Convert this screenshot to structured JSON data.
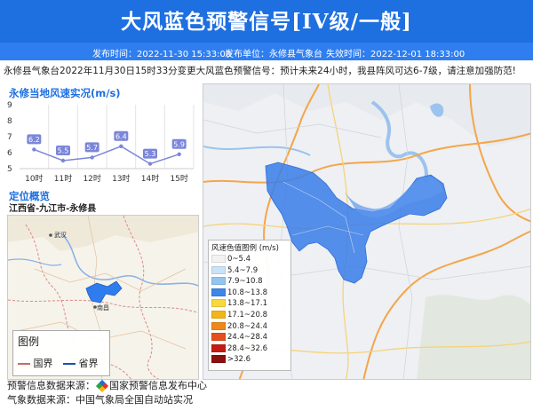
{
  "title": "大风蓝色预警信号[IV级/一般]",
  "subbar": {
    "issue_time": "发布时间：2022-11-30 15:33:00",
    "issuer": "发布单位：永修县气象台",
    "expire_time": "失效时间：2022-12-01 18:33:00"
  },
  "description": "永修县气象台2022年11月30日15时33分变更大风蓝色预警信号：预计未来24小时，我县阵风可达6-7级，请注意加强防范!",
  "wind_panel": {
    "title": "永修当地风速实况(m/s)",
    "y_ticks": [
      "9",
      "8",
      "7",
      "6",
      "5"
    ],
    "points": [
      {
        "hour": "10时",
        "value": 6.2,
        "label": "6.2"
      },
      {
        "hour": "11时",
        "value": 5.5,
        "label": "5.5"
      },
      {
        "hour": "12时",
        "value": 5.7,
        "label": "5.7"
      },
      {
        "hour": "13时",
        "value": 6.4,
        "label": "6.4"
      },
      {
        "hour": "14时",
        "value": 5.3,
        "label": "5.3"
      },
      {
        "hour": "15时",
        "value": 5.9,
        "label": "5.9"
      }
    ]
  },
  "location": {
    "title": "定位概览",
    "path": "江西省-九江市-永修县"
  },
  "minimap": {
    "city_wuhan": "武汉",
    "city_nanchang": "南昌",
    "legend_title": "图例",
    "national_border": "国界",
    "provincial_border": "省界"
  },
  "wind_legend": {
    "title": "风速色值图例 (m/s)",
    "items": [
      {
        "label": "0~5.4",
        "color": "#f2f2f2"
      },
      {
        "label": "5.4~7.9",
        "color": "#c9e3f7"
      },
      {
        "label": "7.9~10.8",
        "color": "#92c6f0"
      },
      {
        "label": "10.8~13.8",
        "color": "#3d86ea"
      },
      {
        "label": "13.8~17.1",
        "color": "#f7d83e"
      },
      {
        "label": "17.1~20.8",
        "color": "#f2b619"
      },
      {
        "label": "20.8~24.4",
        "color": "#f0871b"
      },
      {
        "label": "24.4~28.4",
        "color": "#e4501d"
      },
      {
        "label": "28.4~32.6",
        "color": "#c41c14"
      },
      {
        "label": ">32.6",
        "color": "#8a0f0f"
      }
    ]
  },
  "footer": {
    "warn_source_label": "预警信息数据来源：",
    "warn_source": "国家预警信息发布中心",
    "weather_source": "气象数据来源：中国气象局全国自动站实况"
  },
  "colors": {
    "header": "#1e6fe0",
    "warning_area": "#3d7fe8",
    "line": "#7b86d9"
  }
}
